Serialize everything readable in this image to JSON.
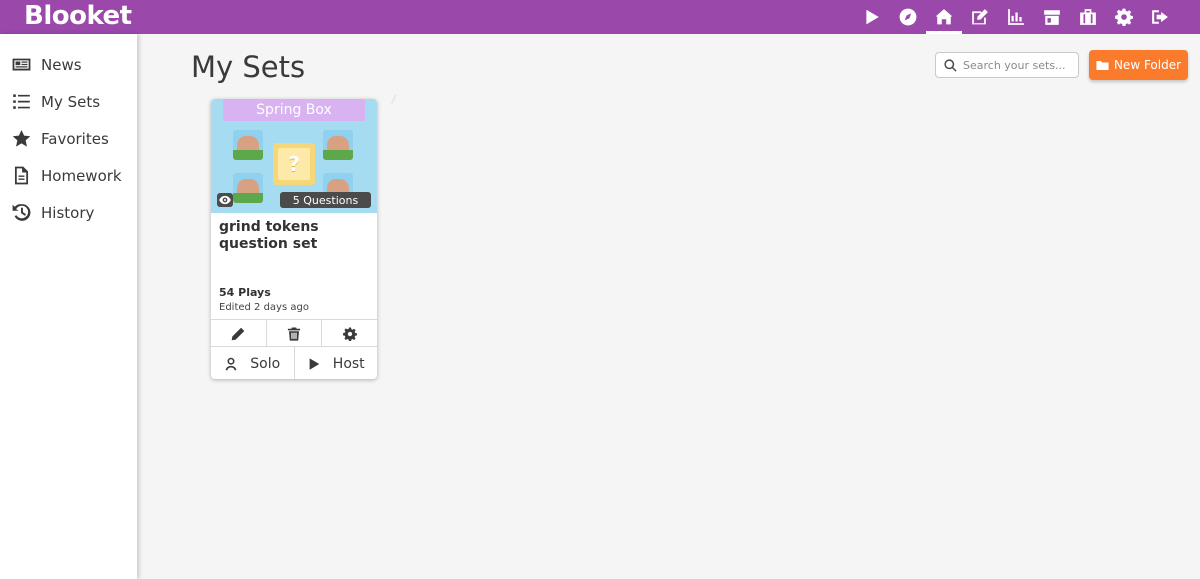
{
  "app": {
    "logo": "Blooket"
  },
  "topnav": {
    "icons": [
      "play-icon",
      "compass-icon",
      "home-icon",
      "edit-icon",
      "stats-icon",
      "market-icon",
      "briefcase-icon",
      "gear-icon",
      "logout-icon"
    ],
    "active": "home-icon"
  },
  "sidebar": {
    "items": [
      {
        "label": "News",
        "icon": "newspaper-icon"
      },
      {
        "label": "My Sets",
        "icon": "list-icon"
      },
      {
        "label": "Favorites",
        "icon": "star-icon"
      },
      {
        "label": "Homework",
        "icon": "document-icon"
      },
      {
        "label": "History",
        "icon": "history-icon"
      }
    ]
  },
  "main": {
    "title": "My Sets",
    "search": {
      "placeholder": "Search your sets..."
    },
    "new_folder_label": "New Folder"
  },
  "set_card": {
    "banner": "Spring Box",
    "mystery_mark": "?",
    "question_count": "5 Questions",
    "title": "grind tokens question set",
    "plays": "54 Plays",
    "edited": "Edited 2 days ago",
    "solo_label": "Solo",
    "host_label": "Host"
  },
  "colors": {
    "topbar": "#9a49aa",
    "accent": "#fa7b2b",
    "banner": "#d9b2f2"
  }
}
